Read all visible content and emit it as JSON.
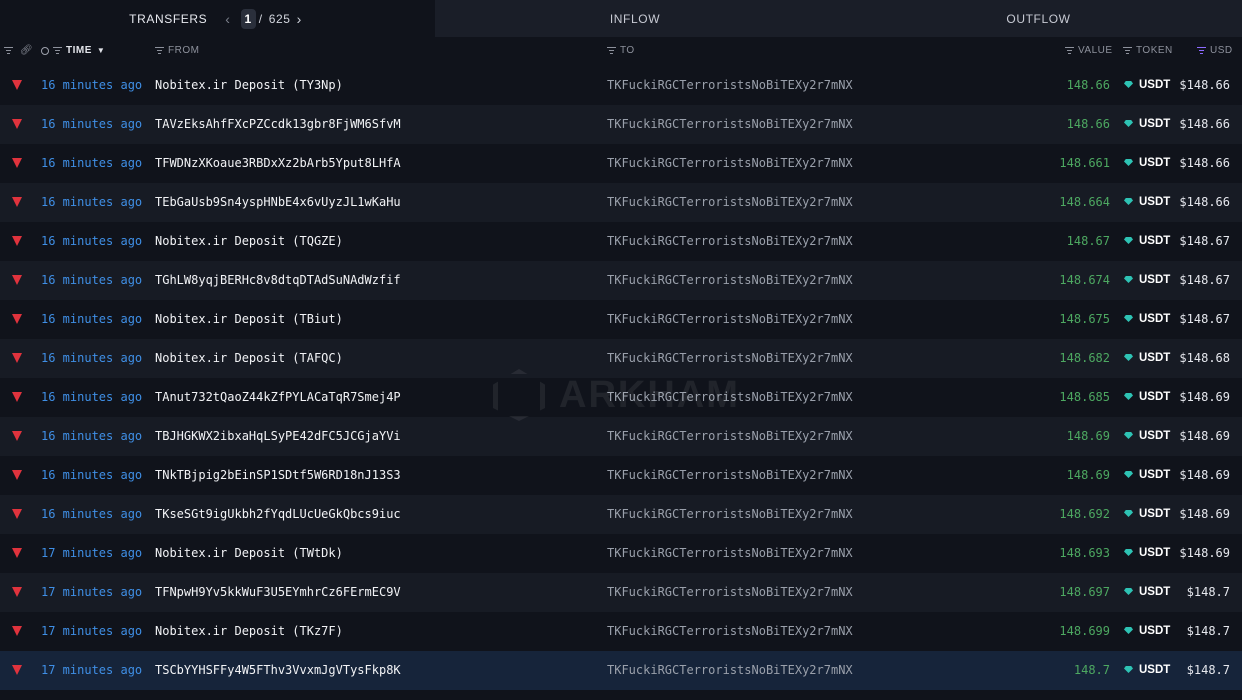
{
  "tabs": {
    "transfers": "TRANSFERS",
    "inflow": "INFLOW",
    "outflow": "OUTFLOW"
  },
  "pager": {
    "current": "1",
    "separator": "/",
    "total": "625",
    "prev_icon": "chevron-left-icon",
    "next_icon": "chevron-right-icon"
  },
  "columns": {
    "time": "TIME",
    "from": "FROM",
    "to": "TO",
    "value": "VALUE",
    "token": "TOKEN",
    "usd": "USD"
  },
  "watermark": "ARKHAM",
  "colors": {
    "background": "#10131b",
    "time_link": "#3f8fe6",
    "value_green": "#4da861",
    "tron_red": "#e0333d",
    "usdt_teal": "#2ec3b4",
    "selected_row": "#16243a"
  },
  "rows": [
    {
      "time": "16 minutes ago",
      "from": "Nobitex.ir Deposit (TY3Np)",
      "to": "TKFuckiRGCTerroristsNoBiTEXy2r7mNX",
      "value": "148.66",
      "token": "USDT",
      "usd": "$148.66"
    },
    {
      "time": "16 minutes ago",
      "from": "TAVzEksAhfFXcPZCcdk13gbr8FjWM6SfvM",
      "to": "TKFuckiRGCTerroristsNoBiTEXy2r7mNX",
      "value": "148.66",
      "token": "USDT",
      "usd": "$148.66"
    },
    {
      "time": "16 minutes ago",
      "from": "TFWDNzXKoaue3RBDxXz2bArb5Yput8LHfA",
      "to": "TKFuckiRGCTerroristsNoBiTEXy2r7mNX",
      "value": "148.661",
      "token": "USDT",
      "usd": "$148.66"
    },
    {
      "time": "16 minutes ago",
      "from": "TEbGaUsb9Sn4yspHNbE4x6vUyzJL1wKaHu",
      "to": "TKFuckiRGCTerroristsNoBiTEXy2r7mNX",
      "value": "148.664",
      "token": "USDT",
      "usd": "$148.66"
    },
    {
      "time": "16 minutes ago",
      "from": "Nobitex.ir Deposit (TQGZE)",
      "to": "TKFuckiRGCTerroristsNoBiTEXy2r7mNX",
      "value": "148.67",
      "token": "USDT",
      "usd": "$148.67"
    },
    {
      "time": "16 minutes ago",
      "from": "TGhLW8yqjBERHc8v8dtqDTAdSuNAdWzfif",
      "to": "TKFuckiRGCTerroristsNoBiTEXy2r7mNX",
      "value": "148.674",
      "token": "USDT",
      "usd": "$148.67"
    },
    {
      "time": "16 minutes ago",
      "from": "Nobitex.ir Deposit (TBiut)",
      "to": "TKFuckiRGCTerroristsNoBiTEXy2r7mNX",
      "value": "148.675",
      "token": "USDT",
      "usd": "$148.67"
    },
    {
      "time": "16 minutes ago",
      "from": "Nobitex.ir Deposit (TAFQC)",
      "to": "TKFuckiRGCTerroristsNoBiTEXy2r7mNX",
      "value": "148.682",
      "token": "USDT",
      "usd": "$148.68"
    },
    {
      "time": "16 minutes ago",
      "from": "TAnut732tQaoZ44kZfPYLACaTqR7Smej4P",
      "to": "TKFuckiRGCTerroristsNoBiTEXy2r7mNX",
      "value": "148.685",
      "token": "USDT",
      "usd": "$148.69"
    },
    {
      "time": "16 minutes ago",
      "from": "TBJHGKWX2ibxaHqLSyPE42dFC5JCGjaYVi",
      "to": "TKFuckiRGCTerroristsNoBiTEXy2r7mNX",
      "value": "148.69",
      "token": "USDT",
      "usd": "$148.69"
    },
    {
      "time": "16 minutes ago",
      "from": "TNkTBjpig2bEinSP1SDtf5W6RD18nJ13S3",
      "to": "TKFuckiRGCTerroristsNoBiTEXy2r7mNX",
      "value": "148.69",
      "token": "USDT",
      "usd": "$148.69"
    },
    {
      "time": "16 minutes ago",
      "from": "TKseSGt9igUkbh2fYqdLUcUeGkQbcs9iuc",
      "to": "TKFuckiRGCTerroristsNoBiTEXy2r7mNX",
      "value": "148.692",
      "token": "USDT",
      "usd": "$148.69"
    },
    {
      "time": "17 minutes ago",
      "from": "Nobitex.ir Deposit (TWtDk)",
      "to": "TKFuckiRGCTerroristsNoBiTEXy2r7mNX",
      "value": "148.693",
      "token": "USDT",
      "usd": "$148.69"
    },
    {
      "time": "17 minutes ago",
      "from": "TFNpwH9Yv5kkWuF3U5EYmhrCz6FErmEC9V",
      "to": "TKFuckiRGCTerroristsNoBiTEXy2r7mNX",
      "value": "148.697",
      "token": "USDT",
      "usd": "$148.7"
    },
    {
      "time": "17 minutes ago",
      "from": "Nobitex.ir Deposit (TKz7F)",
      "to": "TKFuckiRGCTerroristsNoBiTEXy2r7mNX",
      "value": "148.699",
      "token": "USDT",
      "usd": "$148.7"
    },
    {
      "time": "17 minutes ago",
      "from": "TSCbYYHSFFy4W5FThv3VvxmJgVTysFkp8K",
      "to": "TKFuckiRGCTerroristsNoBiTEXy2r7mNX",
      "value": "148.7",
      "token": "USDT",
      "usd": "$148.7"
    }
  ]
}
